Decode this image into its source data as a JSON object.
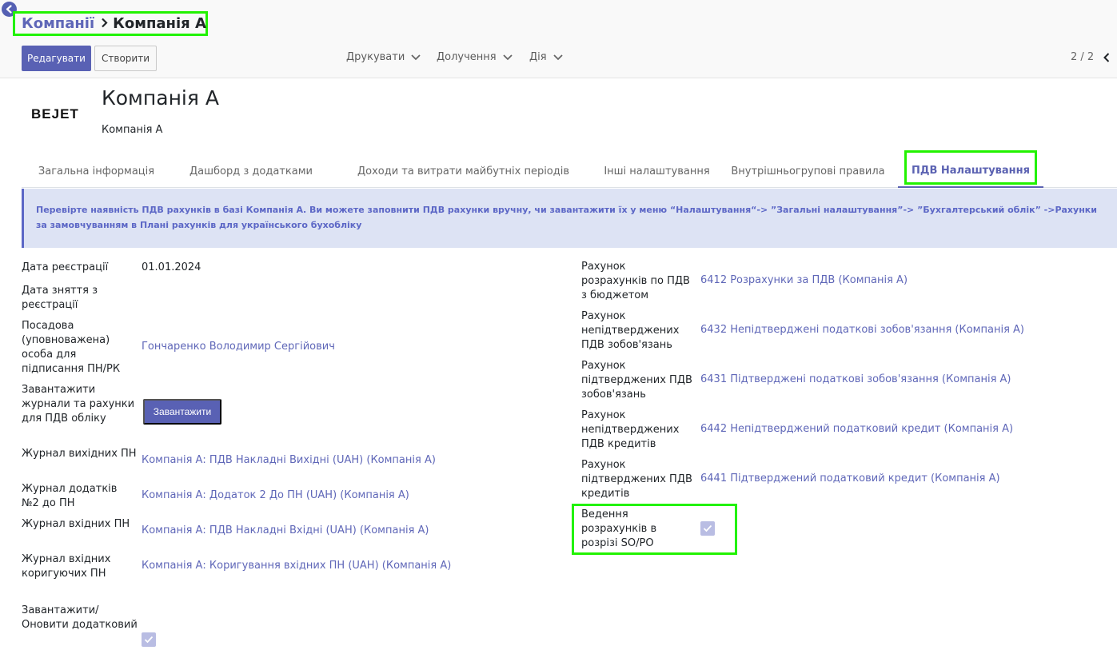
{
  "breadcrumb": {
    "parent": "Компанії",
    "current": "Компанія А"
  },
  "toolbar": {
    "edit_label": "Редагувати",
    "create_label": "Створити",
    "print_label": "Друкувати",
    "attach_label": "Долучення",
    "action_label": "Дія",
    "pager": "2 / 2"
  },
  "record": {
    "title": "Компанія А",
    "subtitle": "Компанія А",
    "logo_text": "BEJET"
  },
  "tabs": [
    {
      "label": "Загальна інформація"
    },
    {
      "label": "Дашборд з додатками"
    },
    {
      "label": "Доходи та витрати майбутніх періодів"
    },
    {
      "label": "Інші налаштування"
    },
    {
      "label": "Внутрішньогрупові правила"
    },
    {
      "label": "ПДВ Налаштування"
    }
  ],
  "active_tab_index": 5,
  "alert": {
    "text": "Перевірте наявність ПДВ рахунків в базі Компанія А. Ви можете заповнити ПДВ рахунки вручну, чи завантажити їх у меню “Налаштування“-> ”Загальні налаштування”-> ”Бухгалтерський облік” ->Рахунки за замовчуванням в Плані рахунків для українського бухобліку"
  },
  "left_fields": {
    "reg_date": {
      "label": "Дата реєстрації",
      "value": "01.01.2024"
    },
    "dereg_date": {
      "label": "Дата зняття з реєстрації"
    },
    "signer": {
      "label": "Посадова (уповноважена) особа для підписання ПН/РК",
      "value": "Гончаренко Володимир Сергійович"
    },
    "load_journals": {
      "label": "Завантажити журнали та рахунки для ПДВ обліку",
      "button": "Завантажити"
    },
    "out_journal": {
      "label": "Журнал вихідних ПН",
      "value": "Компанія А: ПДВ Накладні Вихідні (UAH) (Компанія А)"
    },
    "appendix_journal": {
      "label": "Журнал додатків №2 до ПН",
      "value": "Компанія А: Додаток 2 До ПН (UAH) (Компанія А)"
    },
    "in_journal": {
      "label": "Журнал вхідних ПН",
      "value": "Компанія А: ПДВ Накладні Вхідні (UAH) (Компанія А)"
    },
    "in_correction_journal": {
      "label": "Журнал вхідних коригуючих ПН",
      "value": "Компанія А: Коригування вхідних ПН (UAH) (Компанія А)"
    },
    "load_update": {
      "label": "Завантажити/ Оновити додатковий",
      "checked": true
    }
  },
  "right_fields": {
    "budget_account": {
      "label": "Рахунок розрахунків по ПДВ з бюджетом",
      "value": "6412 Розрахунки за ПДВ (Компанія А)"
    },
    "unconfirmed_liab": {
      "label": "Рахунок непідтверджених ПДВ зобов'язань",
      "value": "6432 Непідтверджені податкові зобов'язання (Компанія А)"
    },
    "confirmed_liab": {
      "label": "Рахунок підтверджених ПДВ зобов'язань",
      "value": "6431 Підтверджені податкові зобов'язання (Компанія А)"
    },
    "unconfirmed_credit": {
      "label": "Рахунок непідтверджених ПДВ кредитів",
      "value": "6442 Непідтверджений податковий кредит (Компанія А)"
    },
    "confirmed_credit": {
      "label": "Рахунок підтверджених ПДВ кредитів",
      "value": "6441 Підтверджений податковий кредит (Компанія А)"
    },
    "so_po": {
      "label": "Ведення розрахунків в розрізі SO/PO",
      "checked": true
    }
  },
  "colors": {
    "primary": "#5961b4",
    "link": "#5f67b8",
    "highlight": "#22f200",
    "alert_bg": "#dde3f4"
  }
}
